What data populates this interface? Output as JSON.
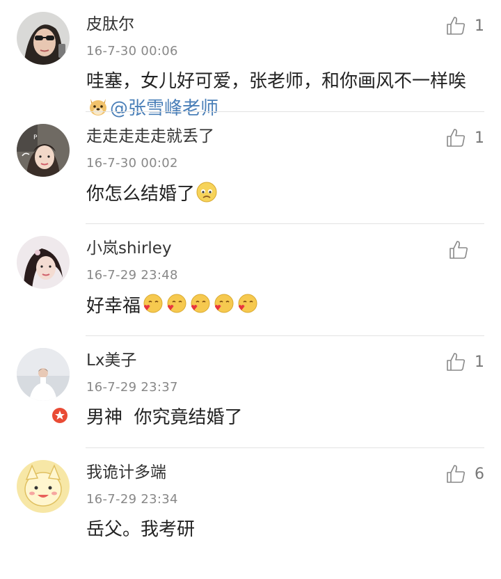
{
  "comments": [
    {
      "name": "皮肽尔",
      "time": "16-7-30 00:06",
      "text": "哇塞，女儿好可爱，张老师，和你画风不一样唉",
      "mention": "@张雪峰老师",
      "likes": "1"
    },
    {
      "name": "走走走走走就丢了",
      "time": "16-7-30 00:02",
      "text": "你怎么结婚了",
      "likes": "1"
    },
    {
      "name": "小岚shirley",
      "time": "16-7-29 23:48",
      "text": "好幸福",
      "likes": ""
    },
    {
      "name": "Lx美子",
      "time": "16-7-29 23:37",
      "text": "男神  你究竟结婚了",
      "likes": "1"
    },
    {
      "name": "我诡计多端",
      "time": "16-7-29 23:34",
      "text": "岳父。我考研",
      "likes": "6"
    }
  ],
  "icons": {
    "like": "thumbs-up-icon",
    "verified": "verified-badge-icon"
  },
  "colors": {
    "mention": "#4a7fb8",
    "divider": "#e2e2e2",
    "badge": "#e94b35"
  }
}
